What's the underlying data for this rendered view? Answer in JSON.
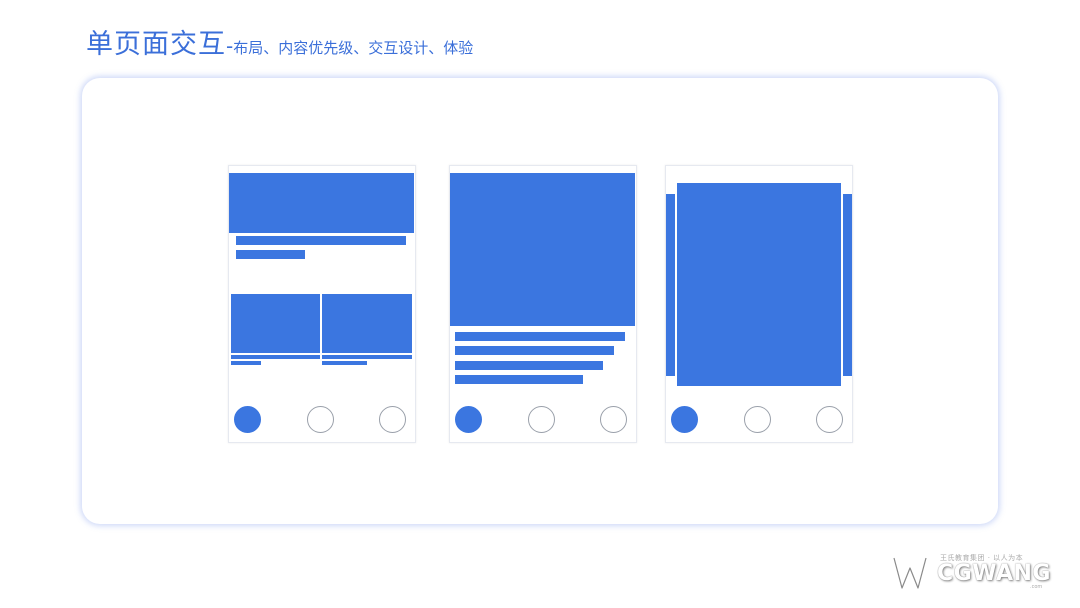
{
  "header": {
    "title": "单页面交互",
    "separator": "-",
    "subtitle": "布局、内容优先级、交互设计、体验"
  },
  "colors": {
    "accent": "#3b76e0",
    "title": "#3b6fd9",
    "card_shadow": "#7896eb"
  },
  "icons": {
    "nav_dot_active": "filled-circle-icon",
    "nav_dot_inactive": "outline-circle-icon"
  },
  "watermark": {
    "brand": "CGWANG",
    "tagline": "王氏教育集团 · 以人为本",
    "domain": ".com"
  }
}
